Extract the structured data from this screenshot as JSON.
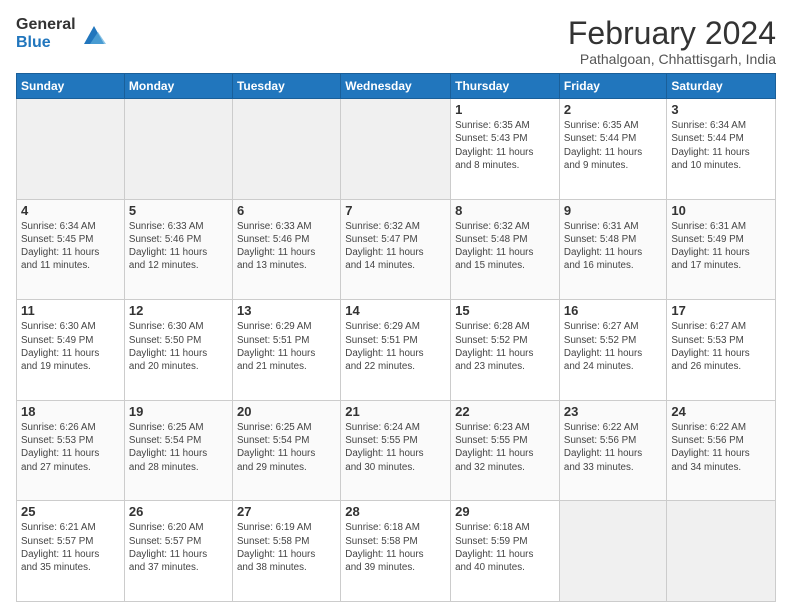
{
  "logo": {
    "general": "General",
    "blue": "Blue"
  },
  "header": {
    "title": "February 2024",
    "subtitle": "Pathalgoan, Chhattisgarh, India"
  },
  "weekdays": [
    "Sunday",
    "Monday",
    "Tuesday",
    "Wednesday",
    "Thursday",
    "Friday",
    "Saturday"
  ],
  "weeks": [
    [
      {
        "day": "",
        "info": ""
      },
      {
        "day": "",
        "info": ""
      },
      {
        "day": "",
        "info": ""
      },
      {
        "day": "",
        "info": ""
      },
      {
        "day": "1",
        "info": "Sunrise: 6:35 AM\nSunset: 5:43 PM\nDaylight: 11 hours\nand 8 minutes."
      },
      {
        "day": "2",
        "info": "Sunrise: 6:35 AM\nSunset: 5:44 PM\nDaylight: 11 hours\nand 9 minutes."
      },
      {
        "day": "3",
        "info": "Sunrise: 6:34 AM\nSunset: 5:44 PM\nDaylight: 11 hours\nand 10 minutes."
      }
    ],
    [
      {
        "day": "4",
        "info": "Sunrise: 6:34 AM\nSunset: 5:45 PM\nDaylight: 11 hours\nand 11 minutes."
      },
      {
        "day": "5",
        "info": "Sunrise: 6:33 AM\nSunset: 5:46 PM\nDaylight: 11 hours\nand 12 minutes."
      },
      {
        "day": "6",
        "info": "Sunrise: 6:33 AM\nSunset: 5:46 PM\nDaylight: 11 hours\nand 13 minutes."
      },
      {
        "day": "7",
        "info": "Sunrise: 6:32 AM\nSunset: 5:47 PM\nDaylight: 11 hours\nand 14 minutes."
      },
      {
        "day": "8",
        "info": "Sunrise: 6:32 AM\nSunset: 5:48 PM\nDaylight: 11 hours\nand 15 minutes."
      },
      {
        "day": "9",
        "info": "Sunrise: 6:31 AM\nSunset: 5:48 PM\nDaylight: 11 hours\nand 16 minutes."
      },
      {
        "day": "10",
        "info": "Sunrise: 6:31 AM\nSunset: 5:49 PM\nDaylight: 11 hours\nand 17 minutes."
      }
    ],
    [
      {
        "day": "11",
        "info": "Sunrise: 6:30 AM\nSunset: 5:49 PM\nDaylight: 11 hours\nand 19 minutes."
      },
      {
        "day": "12",
        "info": "Sunrise: 6:30 AM\nSunset: 5:50 PM\nDaylight: 11 hours\nand 20 minutes."
      },
      {
        "day": "13",
        "info": "Sunrise: 6:29 AM\nSunset: 5:51 PM\nDaylight: 11 hours\nand 21 minutes."
      },
      {
        "day": "14",
        "info": "Sunrise: 6:29 AM\nSunset: 5:51 PM\nDaylight: 11 hours\nand 22 minutes."
      },
      {
        "day": "15",
        "info": "Sunrise: 6:28 AM\nSunset: 5:52 PM\nDaylight: 11 hours\nand 23 minutes."
      },
      {
        "day": "16",
        "info": "Sunrise: 6:27 AM\nSunset: 5:52 PM\nDaylight: 11 hours\nand 24 minutes."
      },
      {
        "day": "17",
        "info": "Sunrise: 6:27 AM\nSunset: 5:53 PM\nDaylight: 11 hours\nand 26 minutes."
      }
    ],
    [
      {
        "day": "18",
        "info": "Sunrise: 6:26 AM\nSunset: 5:53 PM\nDaylight: 11 hours\nand 27 minutes."
      },
      {
        "day": "19",
        "info": "Sunrise: 6:25 AM\nSunset: 5:54 PM\nDaylight: 11 hours\nand 28 minutes."
      },
      {
        "day": "20",
        "info": "Sunrise: 6:25 AM\nSunset: 5:54 PM\nDaylight: 11 hours\nand 29 minutes."
      },
      {
        "day": "21",
        "info": "Sunrise: 6:24 AM\nSunset: 5:55 PM\nDaylight: 11 hours\nand 30 minutes."
      },
      {
        "day": "22",
        "info": "Sunrise: 6:23 AM\nSunset: 5:55 PM\nDaylight: 11 hours\nand 32 minutes."
      },
      {
        "day": "23",
        "info": "Sunrise: 6:22 AM\nSunset: 5:56 PM\nDaylight: 11 hours\nand 33 minutes."
      },
      {
        "day": "24",
        "info": "Sunrise: 6:22 AM\nSunset: 5:56 PM\nDaylight: 11 hours\nand 34 minutes."
      }
    ],
    [
      {
        "day": "25",
        "info": "Sunrise: 6:21 AM\nSunset: 5:57 PM\nDaylight: 11 hours\nand 35 minutes."
      },
      {
        "day": "26",
        "info": "Sunrise: 6:20 AM\nSunset: 5:57 PM\nDaylight: 11 hours\nand 37 minutes."
      },
      {
        "day": "27",
        "info": "Sunrise: 6:19 AM\nSunset: 5:58 PM\nDaylight: 11 hours\nand 38 minutes."
      },
      {
        "day": "28",
        "info": "Sunrise: 6:18 AM\nSunset: 5:58 PM\nDaylight: 11 hours\nand 39 minutes."
      },
      {
        "day": "29",
        "info": "Sunrise: 6:18 AM\nSunset: 5:59 PM\nDaylight: 11 hours\nand 40 minutes."
      },
      {
        "day": "",
        "info": ""
      },
      {
        "day": "",
        "info": ""
      }
    ]
  ]
}
